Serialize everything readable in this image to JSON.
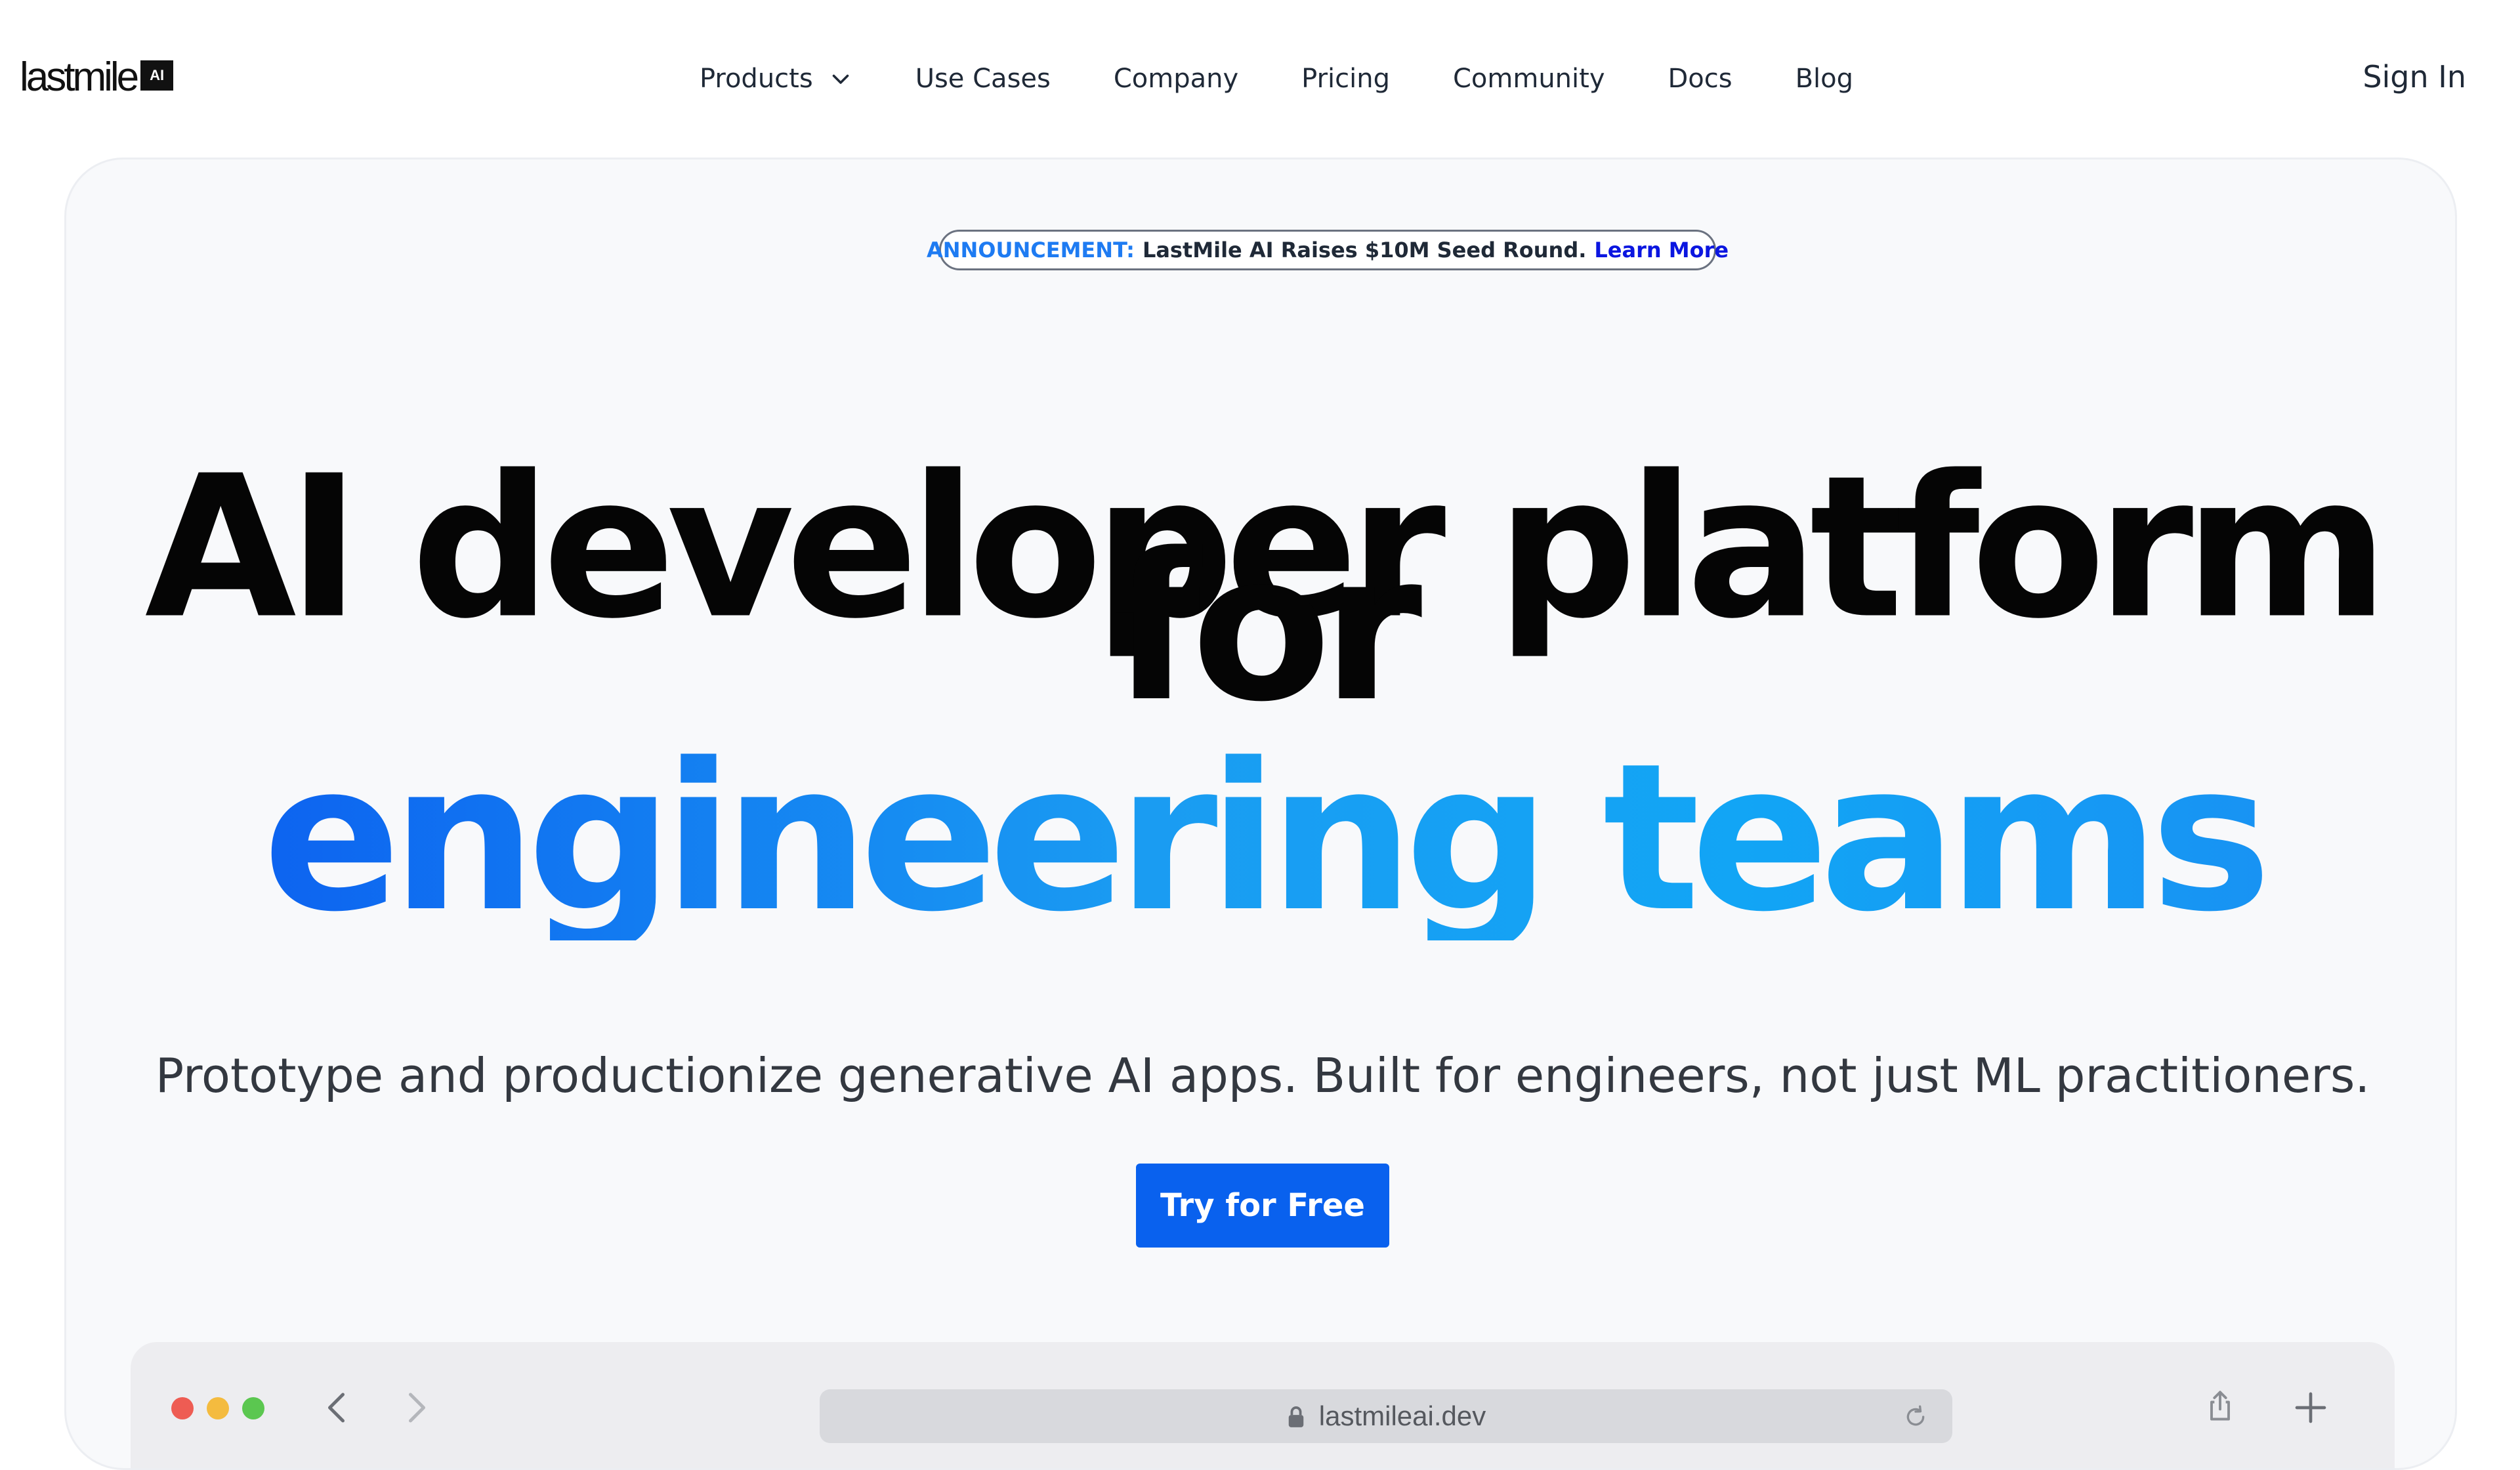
{
  "brand": {
    "name": "lastmile",
    "badge": "AI"
  },
  "nav": {
    "items": [
      {
        "label": "Products",
        "has_dropdown": true
      },
      {
        "label": "Use Cases"
      },
      {
        "label": "Company"
      },
      {
        "label": "Pricing"
      },
      {
        "label": "Community"
      },
      {
        "label": "Docs"
      },
      {
        "label": "Blog"
      }
    ],
    "sign_in": "Sign In"
  },
  "hero": {
    "announcement": {
      "label": "ANNOUNCEMENT:",
      "text": "LastMile AI Raises $10M Seed Round.",
      "link": "Learn More"
    },
    "headline_line1": "AI developer platform",
    "headline_line2": "for",
    "headline_line3": "engineering teams",
    "subtitle": "Prototype and productionize generative AI apps. Built for engineers, not just ML practitioners.",
    "cta": "Try for Free"
  },
  "browser_mockup": {
    "url": "lastmileai.dev",
    "icons": [
      "close-dot",
      "minimize-dot",
      "maximize-dot",
      "back-arrow-icon",
      "forward-arrow-icon",
      "lock-icon",
      "reload-icon",
      "share-icon",
      "plus-icon"
    ]
  },
  "colors": {
    "accent": "#0961ee",
    "gradient_start": "#0a57f0",
    "gradient_end": "#12a5f5",
    "announcement_label": "#1e7bf2",
    "announcement_link": "#0b16e0",
    "card_background": "#f8f9fb"
  }
}
